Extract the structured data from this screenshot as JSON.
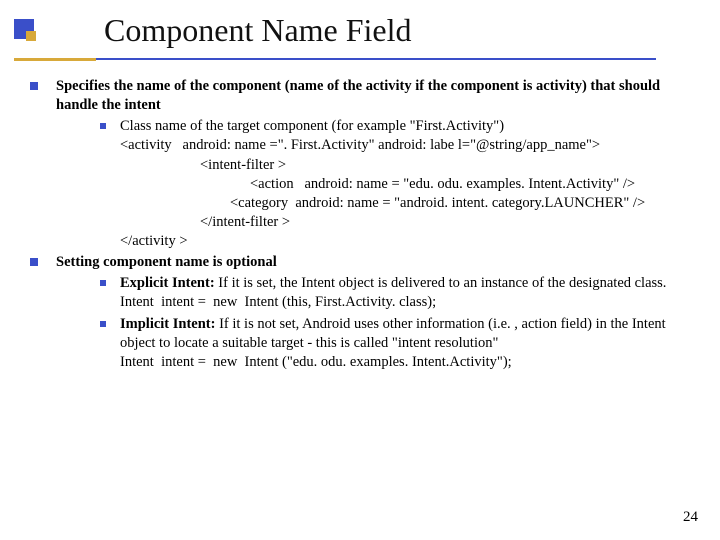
{
  "title": "Component Name Field",
  "bullets": {
    "b1": "Specifies the name of the component (name of the activity if the component is activity) that should handle the intent",
    "b1a_head": "Class name of the target component (for example \"First.Activity\")",
    "b1a_l1": "<activity   android: name =\". First.Activity\" android: labe l=\"@string/app_name\">",
    "b1a_l2": "<intent-filter >",
    "b1a_l3": "<action   android: name = \"edu. odu. examples. Intent.Activity\" />",
    "b1a_l4": "<category  android: name = \"android. intent. category.LAUNCHER\" />",
    "b1a_l5": "</intent-filter >",
    "b1a_l6": "</activity >",
    "b2": "Setting component name is optional",
    "b2a_label": "Explicit Intent:",
    "b2a_rest": " If it is set, the Intent object is delivered to an instance of the designated class.",
    "b2a_code": "Intent  intent =  new  Intent (this, First.Activity. class);",
    "b2b_label": "Implicit Intent:",
    "b2b_rest": " If it is not set, Android uses other information (i.e. , action field) in the Intent object to locate a suitable target - this is called \"intent resolution\"",
    "b2b_code": "Intent  intent =  new  Intent (\"edu. odu. examples. Intent.Activity\");"
  },
  "page_number": "24"
}
